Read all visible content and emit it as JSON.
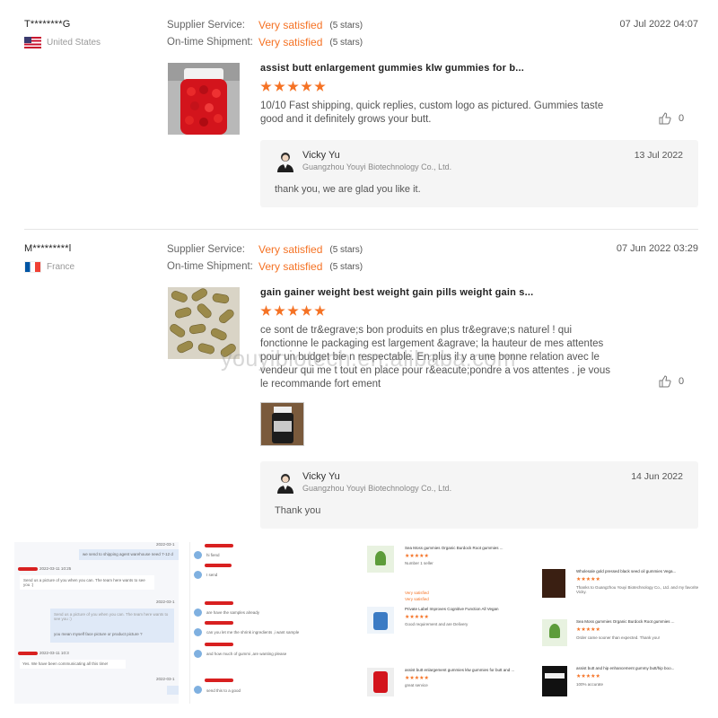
{
  "reviews": [
    {
      "buyer": "T********G",
      "country": "United States",
      "supplier_service_label": "Supplier Service:",
      "supplier_service_value": "Very satisfied",
      "supplier_service_stars": "(5 stars)",
      "shipment_label": "On-time Shipment:",
      "shipment_value": "Very satisfied",
      "shipment_stars": "(5 stars)",
      "date": "07 Jul 2022 04:07",
      "product_title": "assist butt enlargement gummies klw gummies for b...",
      "rating": 5,
      "comment": "10/10 Fast shipping, quick replies, custom logo as pictured. Gummies taste good and it definitely grows your butt.",
      "likes": "0",
      "reply": {
        "name": "Vicky Yu",
        "company": "Guangzhou Youyi Biotechnology Co., Ltd.",
        "date": "13 Jul 2022",
        "text": "thank you, we are glad you like it."
      }
    },
    {
      "buyer": "M*********l",
      "country": "France",
      "supplier_service_label": "Supplier Service:",
      "supplier_service_value": "Very satisfied",
      "supplier_service_stars": "(5 stars)",
      "shipment_label": "On-time Shipment:",
      "shipment_value": "Very satisfied",
      "shipment_stars": "(5 stars)",
      "date": "07 Jun 2022 03:29",
      "product_title": "gain gainer weight best weight gain pills weight gain s...",
      "rating": 5,
      "comment": "ce sont de tr&egrave;s bon produits en plus tr&egrave;s naturel ! qui fonctionne le packaging est largement &agrave; la hauteur de mes attentes pour un budget bie n respectable. En plus il y a une bonne relation avec le vendeur qui me t tout en place pour r&eacute;pondre a vos attentes . je vous le recommande fort ement",
      "likes": "0",
      "reply": {
        "name": "Vicky Yu",
        "company": "Guangzhou Youyi Biotechnology Co., Ltd.",
        "date": "14 Jun 2022",
        "text": "Thank you"
      }
    }
  ],
  "watermark": "youyibiotech.en.alibaba.com",
  "screenshots": {
    "chat1": {
      "lines": [
        "we send to shipping agent warehouse need 7-12 d",
        "Send us a picture of you when you can. The team here wants to see you :)",
        "you mean myself face picture or product picture ?",
        "Yes. We have been communicating all this time!"
      ],
      "times": [
        "2022-03-1",
        "2022-03-11 10:25",
        "2022-03-1",
        "2022-03-11 10:3",
        "2022-03-1"
      ]
    },
    "chat2": {
      "lines": [
        "hi fiend",
        "I send",
        "are have the samples already",
        "can you let me the shrink ingredients ,i want sample",
        "and how much of gummi ,are wanting please",
        "send this to a good"
      ]
    },
    "reviews_list1": [
      {
        "title": "Sea Moss gummies Organic Burdock Root gummies ...",
        "comment": "Number 1 seller",
        "service": "Very satisfied",
        "shipment": "Very satisfied"
      },
      {
        "title": "Private Label Improves Cognitive Function All Vegan",
        "comment": "Good requirement and are Delivery"
      },
      {
        "title": "assist butt enlargement gummies klw gummies for butt and ...",
        "comment": "great service"
      }
    ],
    "reviews_list2": [
      {
        "title": "Wholesale gold pressed black seed oil gummies Vega...",
        "comment": "Thanks to Guangzhou Youyi Biotechnology Co., Ltd. and my favorite Vicky."
      },
      {
        "title": "Sea Moss gummies Organic Burdock Root gummies ...",
        "comment": "Order came sooner than expected. Thank you!"
      },
      {
        "title": "assist butt and hip enhancement gummy butt/hip boo...",
        "comment": "100% accurate"
      }
    ]
  }
}
